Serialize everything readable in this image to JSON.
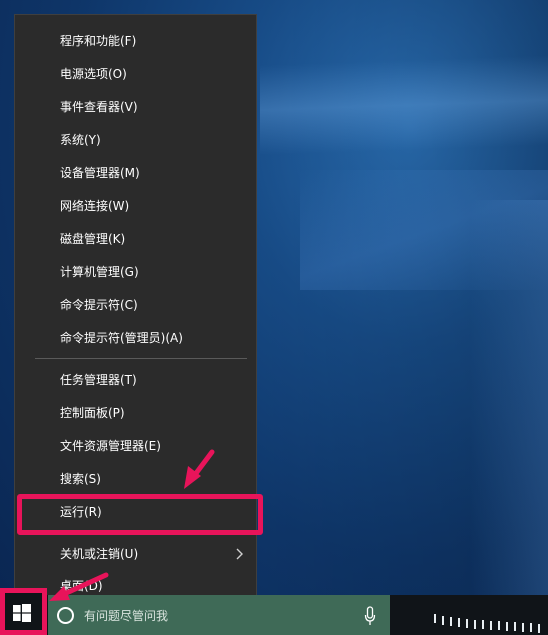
{
  "context_menu": {
    "items": [
      {
        "label": "程序和功能(F)"
      },
      {
        "label": "电源选项(O)"
      },
      {
        "label": "事件查看器(V)"
      },
      {
        "label": "系统(Y)"
      },
      {
        "label": "设备管理器(M)"
      },
      {
        "label": "网络连接(W)"
      },
      {
        "label": "磁盘管理(K)"
      },
      {
        "label": "计算机管理(G)"
      },
      {
        "label": "命令提示符(C)"
      },
      {
        "label": "命令提示符(管理员)(A)"
      },
      {
        "label": "任务管理器(T)"
      },
      {
        "label": "控制面板(P)"
      },
      {
        "label": "文件资源管理器(E)"
      },
      {
        "label": "搜索(S)"
      },
      {
        "label": "运行(R)"
      },
      {
        "label": "关机或注销(U)"
      },
      {
        "label": "桌面(D)"
      }
    ],
    "highlighted_item": "运行(R)"
  },
  "taskbar": {
    "search_placeholder": "有问题尽管问我",
    "start_icon": "windows-logo-icon",
    "mic_icon": "microphone-icon"
  },
  "colors": {
    "menu_background": "#2b2b2b",
    "highlight": "#e8145a",
    "search_box": "#3f6a57",
    "taskbar": "#101418"
  }
}
